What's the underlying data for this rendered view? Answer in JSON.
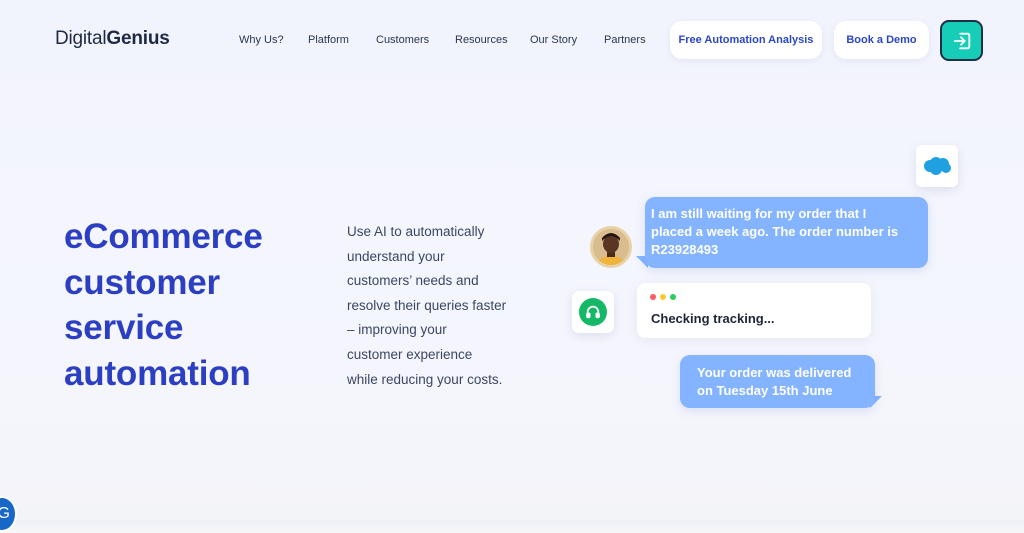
{
  "brand": {
    "logo_light": "Digital",
    "logo_bold": "Genius"
  },
  "nav": {
    "items": [
      {
        "label": "Why Us?"
      },
      {
        "label": "Platform"
      },
      {
        "label": "Customers"
      },
      {
        "label": "Resources"
      },
      {
        "label": "Our Story"
      },
      {
        "label": "Partners"
      }
    ],
    "cta_primary": "Free Automation Analysis",
    "cta_secondary": "Book a Demo",
    "login_icon": "login-arrow-icon"
  },
  "hero": {
    "title_lines": [
      "eCommerce",
      "customer",
      "service",
      "automation"
    ],
    "description_lines": [
      "Use AI to automatically",
      "understand your",
      "customers’ needs and",
      "resolve their queries faster",
      "– improving your",
      "customer experience",
      "while reducing your costs."
    ]
  },
  "chat": {
    "integration_logo": "salesforce",
    "customer_message_lines": [
      "I am still waiting for my order that I",
      "placed a week ago. The order number is",
      "R23928493"
    ],
    "status_text": "Checking tracking...",
    "reply_lines": [
      "Your order was delivered",
      "on Tuesday 15th June"
    ],
    "status_dot_colors": [
      "#ff5b5b",
      "#ffc933",
      "#2ec95f"
    ]
  },
  "widget": {
    "label": "G"
  },
  "colors": {
    "accent": "#2c3fc2",
    "button_text": "#2c46c8",
    "login_bg": "#16cdb7",
    "bubble": "#84b3ff",
    "support_green": "#14b866"
  }
}
